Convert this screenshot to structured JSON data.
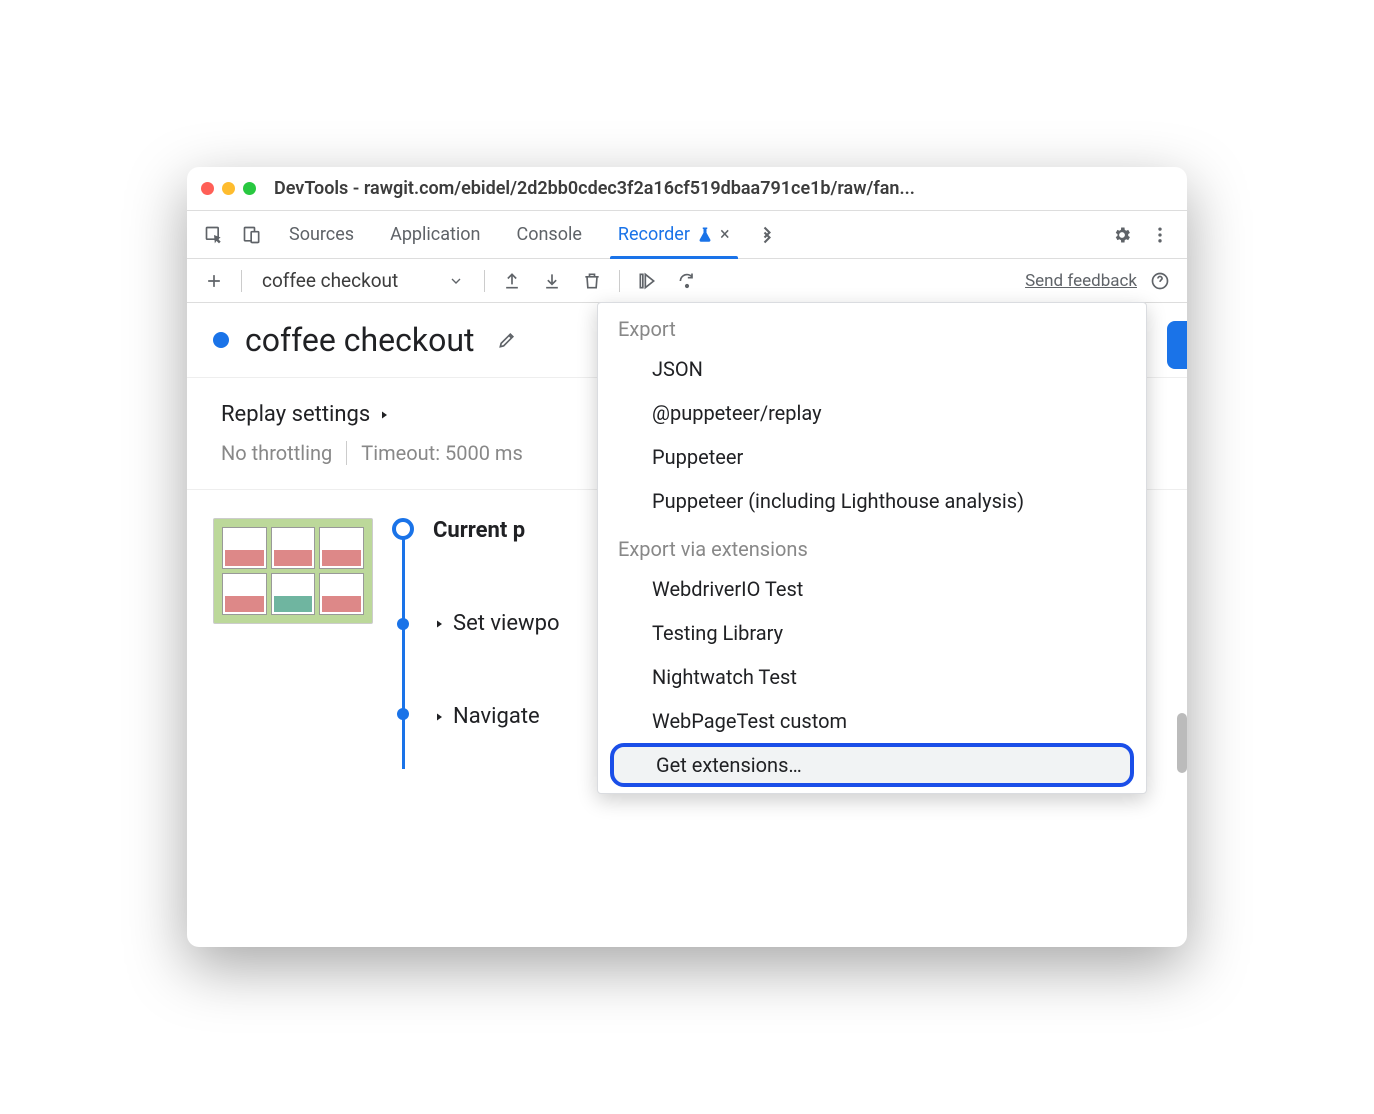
{
  "window": {
    "title": "DevTools - rawgit.com/ebidel/2d2bb0cdec3f2a16cf519dbaa791ce1b/raw/fan..."
  },
  "tabs": {
    "sources": "Sources",
    "application": "Application",
    "console": "Console",
    "recorder": "Recorder"
  },
  "toolbar": {
    "recording_name": "coffee checkout",
    "send_feedback": "Send feedback"
  },
  "recording": {
    "title": "coffee checkout"
  },
  "replay": {
    "heading": "Replay settings",
    "throttling": "No throttling",
    "timeout": "Timeout: 5000 ms"
  },
  "steps": {
    "current": "Current p",
    "set_viewport": "Set viewpo",
    "navigate": "Navigate"
  },
  "dropdown": {
    "export_head": "Export",
    "json": "JSON",
    "puppeteer_replay": "@puppeteer/replay",
    "puppeteer": "Puppeteer",
    "puppeteer_lighthouse": "Puppeteer (including Lighthouse analysis)",
    "ext_head": "Export via extensions",
    "webdriverio": "WebdriverIO Test",
    "testing_library": "Testing Library",
    "nightwatch": "Nightwatch Test",
    "webpagetest": "WebPageTest custom",
    "get_extensions": "Get extensions…"
  }
}
